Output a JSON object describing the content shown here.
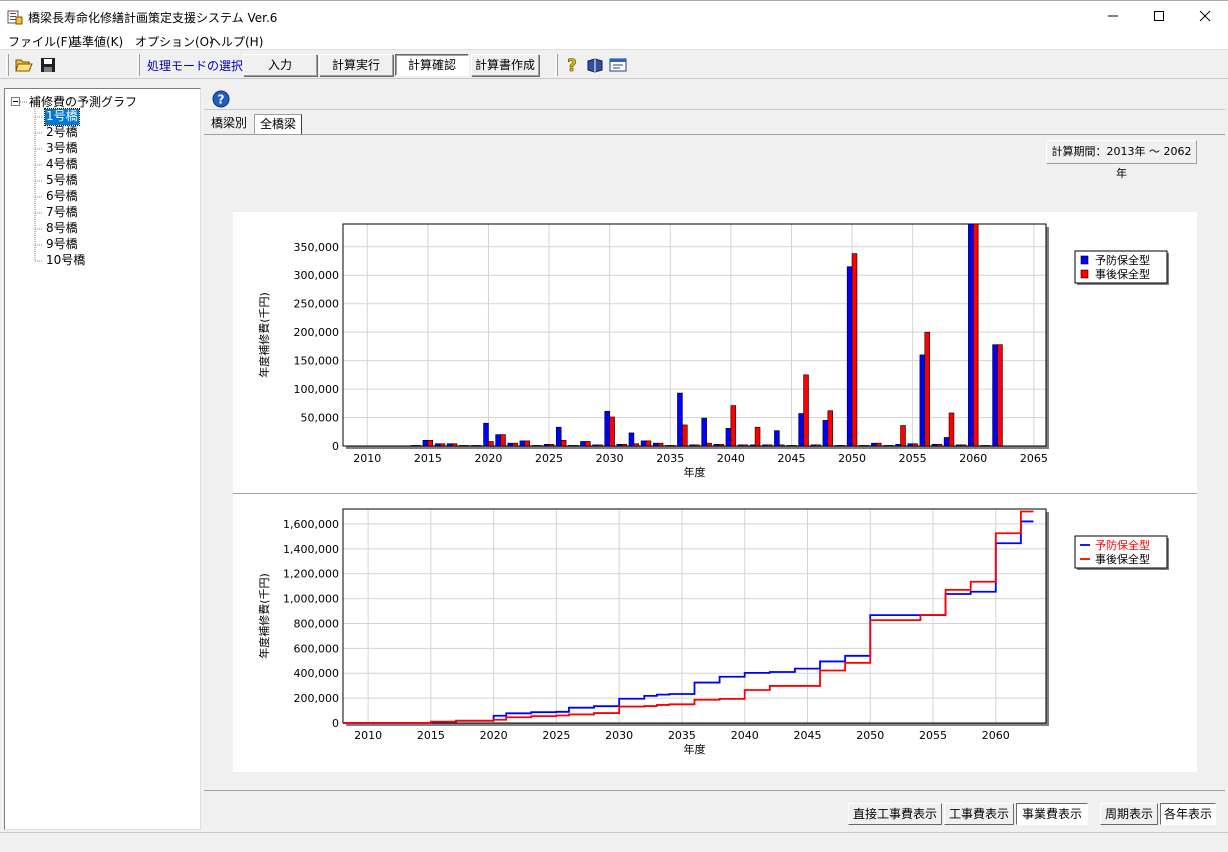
{
  "window": {
    "title": "橋梁長寿命化修繕計画策定支援システム Ver.6"
  },
  "menu": [
    "ファイル(F)",
    "基準値(K)",
    "オプション(O)",
    "ヘルプ(H)"
  ],
  "toolbar": {
    "mode_label": "処理モードの選択",
    "modes": [
      "入力",
      "計算実行",
      "計算確認",
      "計算書作成"
    ],
    "active_mode": "計算確認"
  },
  "tree": {
    "root": "補修費の予測グラフ",
    "items": [
      "1号橋",
      "2号橋",
      "3号橋",
      "4号橋",
      "5号橋",
      "6号橋",
      "7号橋",
      "8号橋",
      "9号橋",
      "10号橋"
    ],
    "selected": "1号橋"
  },
  "tabs": [
    "橋梁別",
    "全橋梁"
  ],
  "active_tab": "全橋梁",
  "period": "計算期間：2013年 ～ 2062年",
  "bottom_buttons": {
    "group1": [
      "直接工事費表示",
      "工事費表示",
      "事業費表示"
    ],
    "group2": [
      "周期表示",
      "各年表示"
    ],
    "active1": "事業費表示",
    "active2": "各年表示"
  },
  "colors": {
    "preventive": "#0000ff",
    "reactive": "#ff0000",
    "selection": "#0078d7"
  },
  "chart_data": [
    {
      "type": "bar",
      "xlabel": "年度",
      "ylabel": "年度補修費(千円)",
      "xlim": [
        2008,
        2066
      ],
      "ylim": [
        0,
        390000
      ],
      "x_ticks": [
        2010,
        2015,
        2020,
        2025,
        2030,
        2035,
        2040,
        2045,
        2050,
        2055,
        2060,
        2065
      ],
      "y_ticks": [
        0,
        50000,
        100000,
        150000,
        200000,
        250000,
        300000,
        350000
      ],
      "y_tick_labels": [
        "0",
        "50,000",
        "100,000",
        "150,000",
        "200,000",
        "250,000",
        "300,000",
        "350,000"
      ],
      "legend": {
        "position": "top-right",
        "entries": [
          "予防保全型",
          "事後保全型"
        ]
      },
      "grid": true,
      "categories": [
        2013,
        2014,
        2015,
        2016,
        2017,
        2018,
        2019,
        2020,
        2021,
        2022,
        2023,
        2024,
        2025,
        2026,
        2027,
        2028,
        2029,
        2030,
        2031,
        2032,
        2033,
        2034,
        2035,
        2036,
        2037,
        2038,
        2039,
        2040,
        2041,
        2042,
        2043,
        2044,
        2045,
        2046,
        2047,
        2048,
        2049,
        2050,
        2051,
        2052,
        2053,
        2054,
        2055,
        2056,
        2057,
        2058,
        2059,
        2060,
        2061,
        2062
      ],
      "series": [
        {
          "name": "予防保全型",
          "values": [
            0,
            1000,
            10000,
            4000,
            4000,
            1000,
            1000,
            40000,
            20000,
            5000,
            9000,
            1000,
            3000,
            33000,
            1000,
            8000,
            2000,
            61000,
            3000,
            23000,
            9000,
            5000,
            1000,
            93000,
            2000,
            49000,
            3000,
            31000,
            2000,
            2000,
            2000,
            27000,
            1000,
            57000,
            2000,
            45000,
            1000,
            315000,
            1000,
            5000,
            1000,
            3000,
            4000,
            160000,
            3000,
            15000,
            2000,
            390000,
            1000,
            178000
          ]
        },
        {
          "name": "事後保全型",
          "values": [
            0,
            1000,
            10000,
            4000,
            4000,
            1000,
            1000,
            8000,
            20000,
            5000,
            9000,
            1000,
            3000,
            10000,
            1000,
            8000,
            2000,
            51000,
            3000,
            4000,
            9000,
            5000,
            1000,
            37000,
            2000,
            5000,
            3000,
            71000,
            2000,
            33000,
            2000,
            2000,
            1000,
            125000,
            2000,
            62000,
            1000,
            338000,
            1000,
            5000,
            1000,
            36000,
            4000,
            200000,
            3000,
            58000,
            2000,
            390000,
            1000,
            178000
          ]
        }
      ]
    },
    {
      "type": "line",
      "step": true,
      "xlabel": "年度",
      "ylabel": "年度補修費(千円)",
      "xlim": [
        2008,
        2064
      ],
      "ylim": [
        0,
        1720000
      ],
      "x_ticks": [
        2010,
        2015,
        2020,
        2025,
        2030,
        2035,
        2040,
        2045,
        2050,
        2055,
        2060
      ],
      "y_ticks": [
        0,
        200000,
        400000,
        600000,
        800000,
        1000000,
        1200000,
        1400000,
        1600000
      ],
      "y_tick_labels": [
        "0",
        "200,000",
        "400,000",
        "600,000",
        "800,000",
        "1,000,000",
        "1,200,000",
        "1,400,000",
        "1,600,000"
      ],
      "legend": {
        "position": "top-right",
        "entries": [
          "予防保全型",
          "事後保全型"
        ]
      },
      "grid": true,
      "x": [
        2008,
        2013,
        2015,
        2017,
        2020,
        2021,
        2023,
        2025,
        2026,
        2028,
        2030,
        2032,
        2033,
        2034,
        2036,
        2038,
        2040,
        2042,
        2044,
        2046,
        2048,
        2050,
        2054,
        2056,
        2058,
        2060,
        2062,
        2063
      ],
      "series": [
        {
          "name": "予防保全型",
          "values": [
            0,
            1000,
            10000,
            18000,
            58000,
            78000,
            87000,
            90000,
            123000,
            135000,
            195000,
            218000,
            228000,
            233000,
            325000,
            372000,
            403000,
            410000,
            437000,
            495000,
            540000,
            867000,
            867000,
            1037000,
            1055000,
            1445000,
            1620000,
            1620000
          ]
        },
        {
          "name": "事後保全型",
          "values": [
            0,
            1000,
            10000,
            18000,
            26000,
            46000,
            55000,
            60000,
            69000,
            80000,
            132000,
            136000,
            145000,
            150000,
            187000,
            194000,
            265000,
            298000,
            298000,
            422000,
            483000,
            827000,
            868000,
            1070000,
            1135000,
            1525000,
            1700000,
            1700000
          ]
        }
      ]
    }
  ]
}
